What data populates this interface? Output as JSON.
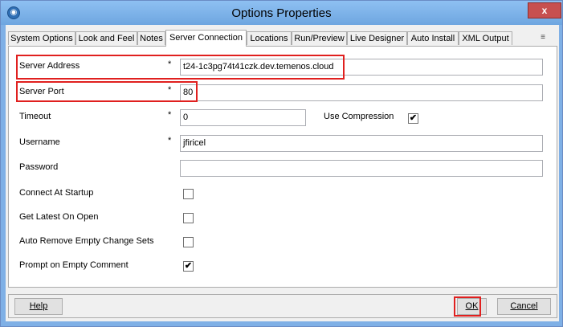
{
  "window": {
    "title": "Options Properties",
    "close_label": "x",
    "app_icon": "globe-icon"
  },
  "tabs": [
    {
      "label": "System Options"
    },
    {
      "label": "Look and Feel"
    },
    {
      "label": "Notes"
    },
    {
      "label": "Server Connection",
      "active": true
    },
    {
      "label": "Locations"
    },
    {
      "label": "Run/Preview"
    },
    {
      "label": "Live Designer"
    },
    {
      "label": "Auto Install"
    },
    {
      "label": "XML Output"
    }
  ],
  "tab_overflow_icon": "menu-icon",
  "form": {
    "server_address": {
      "label": "Server Address",
      "required": "*",
      "value": "t24-1c3pg74t41czk.dev.temenos.cloud"
    },
    "server_port": {
      "label": "Server Port",
      "required": "*",
      "value": "80"
    },
    "timeout": {
      "label": "Timeout",
      "required": "*",
      "value": "0"
    },
    "use_compression": {
      "label": "Use Compression",
      "checked": true,
      "mark": "✔"
    },
    "username": {
      "label": "Username",
      "required": "*",
      "value": "jfiricel"
    },
    "password": {
      "label": "Password",
      "value": ""
    },
    "connect_at_startup": {
      "label": "Connect At Startup",
      "checked": false,
      "mark": ""
    },
    "get_latest_on_open": {
      "label": "Get Latest On Open",
      "checked": false,
      "mark": ""
    },
    "auto_remove_empty": {
      "label": "Auto Remove Empty Change Sets",
      "checked": false,
      "mark": ""
    },
    "prompt_on_empty": {
      "label": "Prompt on Empty Comment",
      "checked": true,
      "mark": "✔"
    }
  },
  "buttons": {
    "help": "Help",
    "ok": "OK",
    "cancel": "Cancel"
  },
  "colors": {
    "highlight": "#e0201f",
    "titlebar": "#7fb0e6"
  }
}
